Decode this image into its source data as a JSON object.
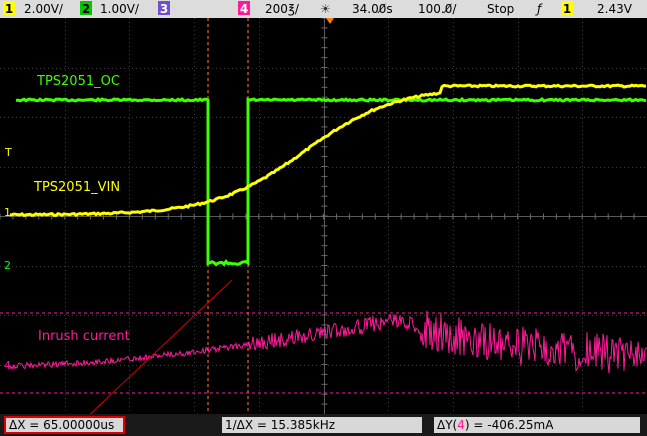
{
  "topbar": {
    "ch1_num": "1",
    "ch1_scale": "2.00V/",
    "ch2_num": "2",
    "ch2_scale": "1.00V/",
    "ch3_num": "3",
    "ch4_num": "4",
    "timebase": "200℥/",
    "trigger_icon": "☀",
    "delay": "34.00̸s",
    "zoom": "100.0̸/",
    "run_state": "Stop",
    "trigger_slope": "ƒ",
    "trig_ch_num": "1",
    "trig_level": "2.43V"
  },
  "labels": {
    "oc": "TPS2051_OC",
    "vin": "TPS2051_VIN",
    "inrush": "Inrush current"
  },
  "markers": {
    "trigger_marker": "T",
    "ch1_marker": "1",
    "ch2_marker": "2",
    "ch4_marker": "4"
  },
  "measurements": {
    "dx": "ΔX = 65.00000us",
    "inv_dx": "1/ΔX = 15.385kHz",
    "dy_prefix": "ΔY(",
    "dy_ch": "4",
    "dy_suffix": ") = -406.25mA"
  },
  "colors": {
    "ch1": "#ffff00",
    "ch2": "#00ff00",
    "ch3": "#8060ff",
    "ch4": "#ff1a9a",
    "highlight": "#e00000"
  }
}
